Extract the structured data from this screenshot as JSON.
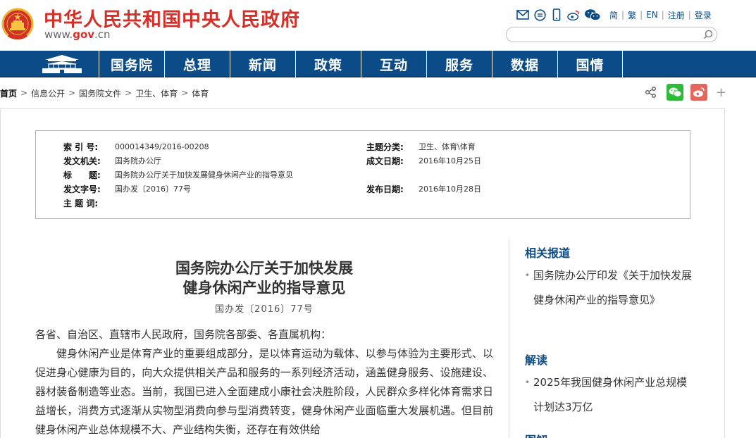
{
  "header": {
    "title": "中华人民共和国中央人民政府",
    "domain_prefix": "www.",
    "domain_main": "gov",
    "domain_suffix": ".cn",
    "social_icons": [
      "mail-icon",
      "chat-bubble-icon",
      "mobile-icon",
      "weibo-icon",
      "wechat-icon"
    ],
    "lang_simplified": "简",
    "lang_traditional": "繁",
    "lang_en": "EN",
    "register": "注册",
    "login": "登录",
    "search_placeholder": ""
  },
  "nav": {
    "items": [
      "国务院",
      "总理",
      "新闻",
      "政策",
      "互动",
      "服务",
      "数据",
      "国情"
    ]
  },
  "breadcrumb": {
    "home": "首页",
    "items": [
      "信息公开",
      "国务院文件",
      "卫生、体育",
      "体育"
    ]
  },
  "meta": {
    "index_label": "索 引 号:",
    "index_value": "000014349/2016-00208",
    "topic_label": "主题分类:",
    "topic_value": "卫生、体育\\体育",
    "issuer_label": "发文机关:",
    "issuer_value": "国务院办公厅",
    "date_made_label": "成文日期:",
    "date_made_value": "2016年10月25日",
    "title_label": "标　　题:",
    "title_value": "国务院办公厅关于加快发展健身休闲产业的指导意见",
    "doc_no_label": "发文字号:",
    "doc_no_value": "国办发〔2016〕77号",
    "pub_date_label": "发布日期:",
    "pub_date_value": "2016年10月28日",
    "keywords_label": "主 题 词:",
    "keywords_value": ""
  },
  "article": {
    "title_line1": "国务院办公厅关于加快发展",
    "title_line2": "健身休闲产业的指导意见",
    "doc_no": "国办发〔2016〕77号",
    "salutation": "各省、自治区、直辖市人民政府，国务院各部委、各直属机构：",
    "para1": "健身休闲产业是体育产业的重要组成部分，是以体育运动为载体、以参与体验为主要形式、以促进身心健康为目的，向大众提供相关产品和服务的一系列经济活动，涵盖健身服务、设施建设、器材装备制造等业态。当前，我国已进入全面建成小康社会决胜阶段，人民群众多样化体育需求日益增长，消费方式逐渐从实物型消费向参与型消费转变，健身休闲产业面临重大发展机遇。但目前健身休闲产业总体规模不大、产业结构失衡，还存在有效供给"
  },
  "sidebar": {
    "related_heading": "相关报道",
    "related_items": [
      "国务院办公厅印发《关于加快发展健身休闲产业的指导意见》"
    ],
    "interpret_heading": "解读",
    "interpret_items": [
      "2025年我国健身休闲产业总规模计划达3万亿"
    ],
    "third_heading": "图解"
  },
  "colors": {
    "brand_red": "#d3302a",
    "nav_blue": "#0b4c88",
    "wechat_green": "#2dbb38",
    "weibo_red": "#e5675b"
  }
}
